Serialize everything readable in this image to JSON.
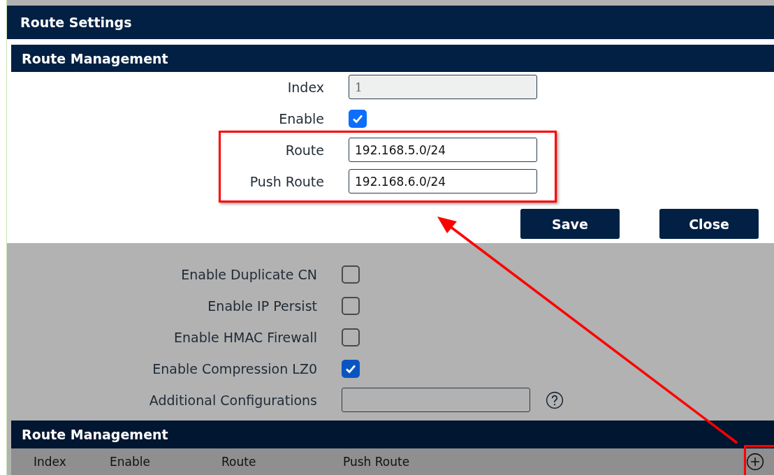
{
  "dialog": {
    "title": "Route Settings",
    "section_title": "Route Management",
    "fields": [
      {
        "kind": "text",
        "label": "Index",
        "value": "1",
        "disabled": true
      },
      {
        "kind": "checkbox",
        "label": "Enable",
        "checked": true
      },
      {
        "kind": "text",
        "label": "Route",
        "value": "192.168.5.0/24",
        "disabled": false
      },
      {
        "kind": "text",
        "label": "Push Route",
        "value": "192.168.6.0/24",
        "disabled": false
      }
    ],
    "buttons": [
      {
        "label": "Save"
      },
      {
        "label": "Close"
      }
    ]
  },
  "settings": [
    {
      "kind": "checkbox",
      "label": "Enable Duplicate CN",
      "checked": false
    },
    {
      "kind": "checkbox",
      "label": "Enable IP Persist",
      "checked": false
    },
    {
      "kind": "checkbox",
      "label": "Enable HMAC Firewall",
      "checked": false
    },
    {
      "kind": "checkbox",
      "label": "Enable Compression LZ0",
      "checked": true
    },
    {
      "kind": "text",
      "label": "Additional Configurations",
      "help": true
    }
  ],
  "route_table": {
    "title": "Route Management",
    "columns": [
      "Index",
      "Enable",
      "Route",
      "Push Route"
    ],
    "add_button": true
  },
  "annotations": [
    {
      "kind": "highlight_box"
    },
    {
      "kind": "highlight_box"
    },
    {
      "kind": "arrow"
    }
  ]
}
